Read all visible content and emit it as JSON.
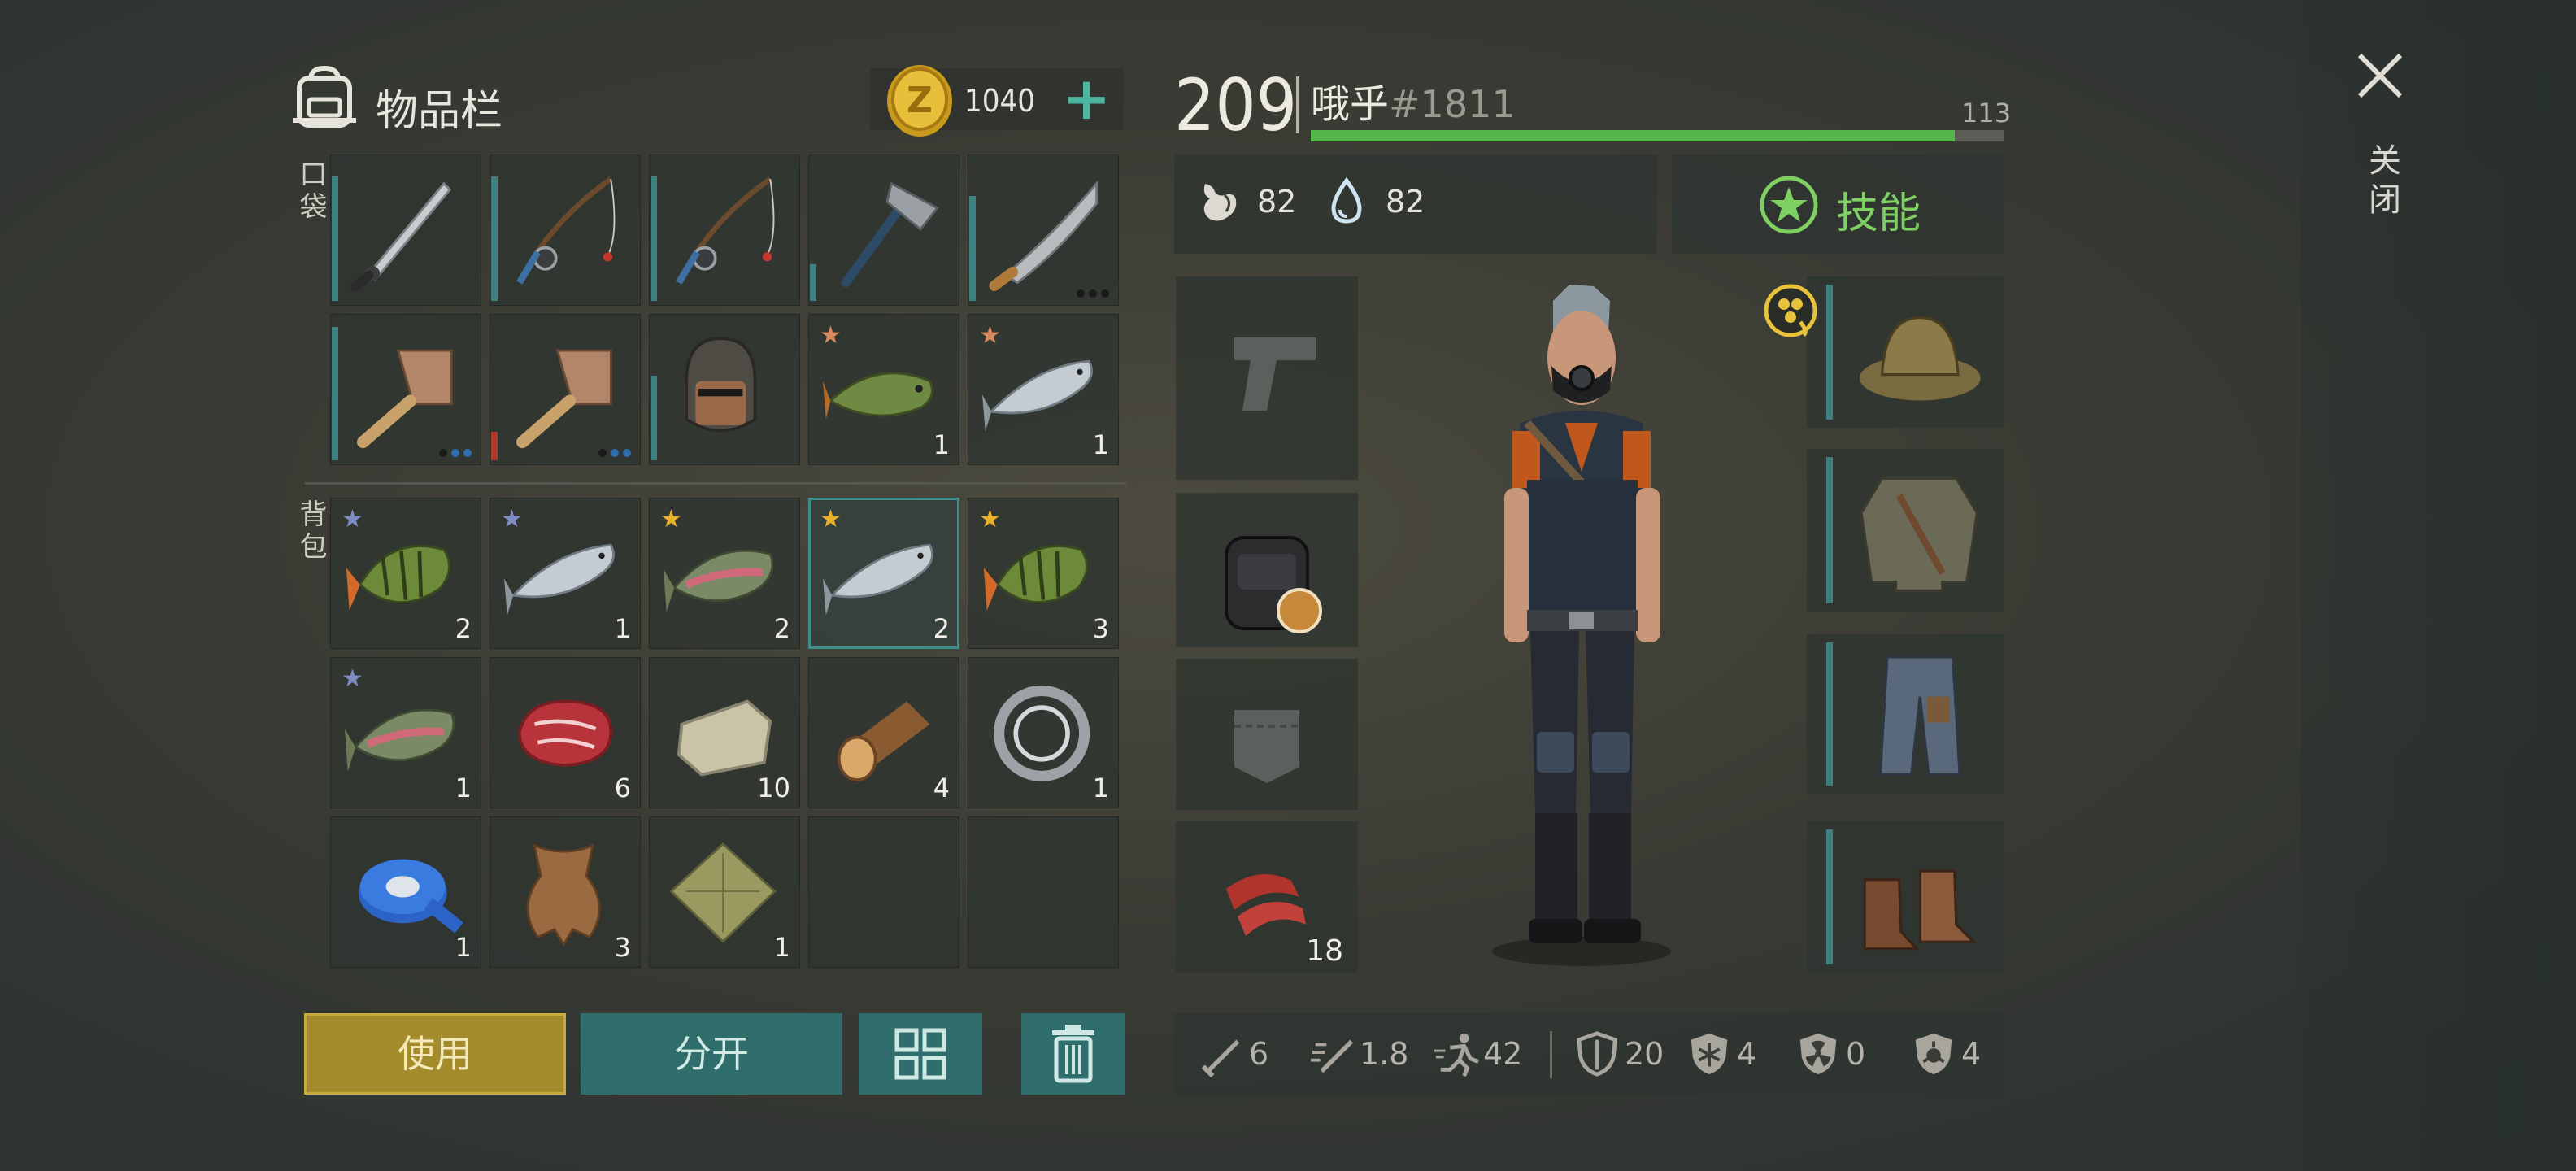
{
  "inventory": {
    "title": "物品栏",
    "coins": "1040",
    "pocket_label": "口袋",
    "backpack_label": "背包",
    "pocket": [
      {
        "item": "katana",
        "durability": 0.88
      },
      {
        "item": "fishing-rod",
        "durability": 0.88
      },
      {
        "item": "fishing-rod",
        "durability": 0.88
      },
      {
        "item": "axe",
        "durability": 0.26
      },
      {
        "item": "machete",
        "durability": 0.74,
        "dots": [
          "#1a1a1a",
          "#1a1a1a",
          "#1a1a1a"
        ]
      },
      {
        "item": "cleaver",
        "durability": 0.94,
        "dots": [
          "#1a1a1a",
          "#2f6fb0",
          "#2f6fb0"
        ]
      },
      {
        "item": "cleaver",
        "durability": 0.2,
        "durability_color": "red",
        "dots": [
          "#1a1a1a",
          "#2f6fb0",
          "#2f6fb0"
        ]
      },
      {
        "item": "mask-helmet",
        "durability": 0.6
      },
      {
        "item": "pike-fish",
        "star": "bronze",
        "qty": "1"
      },
      {
        "item": "salmon",
        "star": "bronze",
        "qty": "1"
      }
    ],
    "backpack": [
      {
        "item": "perch",
        "star": "silver",
        "qty": "2"
      },
      {
        "item": "salmon",
        "star": "silver",
        "qty": "1"
      },
      {
        "item": "trout",
        "star": "gold",
        "qty": "2"
      },
      {
        "item": "salmon",
        "star": "gold",
        "qty": "2",
        "selected": true
      },
      {
        "item": "perch",
        "star": "gold",
        "qty": "3"
      },
      {
        "item": "trout",
        "star": "silver",
        "qty": "1"
      },
      {
        "item": "raw-meat",
        "qty": "6"
      },
      {
        "item": "stone",
        "qty": "10"
      },
      {
        "item": "log",
        "qty": "4"
      },
      {
        "item": "bearing",
        "qty": "1"
      },
      {
        "item": "tape",
        "qty": "1"
      },
      {
        "item": "hide",
        "qty": "3"
      },
      {
        "item": "cloth",
        "qty": "1"
      },
      {
        "item": ""
      },
      {
        "item": ""
      }
    ],
    "buttons": {
      "use": "使用",
      "split": "分开"
    }
  },
  "character": {
    "level": "209",
    "name": "哦乎",
    "tag": "#1811",
    "xp_value": "113",
    "xp_progress": 0.93,
    "food": "82",
    "water": "82",
    "skills_label": "技能",
    "left_slots": [
      {
        "item": "pistol-placeholder"
      },
      {
        "item": "backpack"
      },
      {
        "item": "pocket-placeholder"
      },
      {
        "item": "bacon",
        "qty": "18"
      }
    ],
    "right_slots": [
      {
        "item": "hat"
      },
      {
        "item": "jacket"
      },
      {
        "item": "pants"
      },
      {
        "item": "boots"
      }
    ]
  },
  "stats": [
    {
      "icon": "damage-icon",
      "value": "6"
    },
    {
      "icon": "attack-speed-icon",
      "value": "1.8"
    },
    {
      "icon": "move-speed-icon",
      "value": "42"
    },
    {
      "icon": "armor-icon",
      "value": "20"
    },
    {
      "icon": "cold-resist-icon",
      "value": "4"
    },
    {
      "icon": "radiation-resist-icon",
      "value": "0"
    },
    {
      "icon": "toxic-resist-icon",
      "value": "4"
    }
  ],
  "close_label": "关闭",
  "colors": {
    "accent_teal": "#2f6e6c",
    "use_gold": "#a48b2b",
    "xp_green": "#55b74a",
    "skills_green": "#7fd063"
  }
}
